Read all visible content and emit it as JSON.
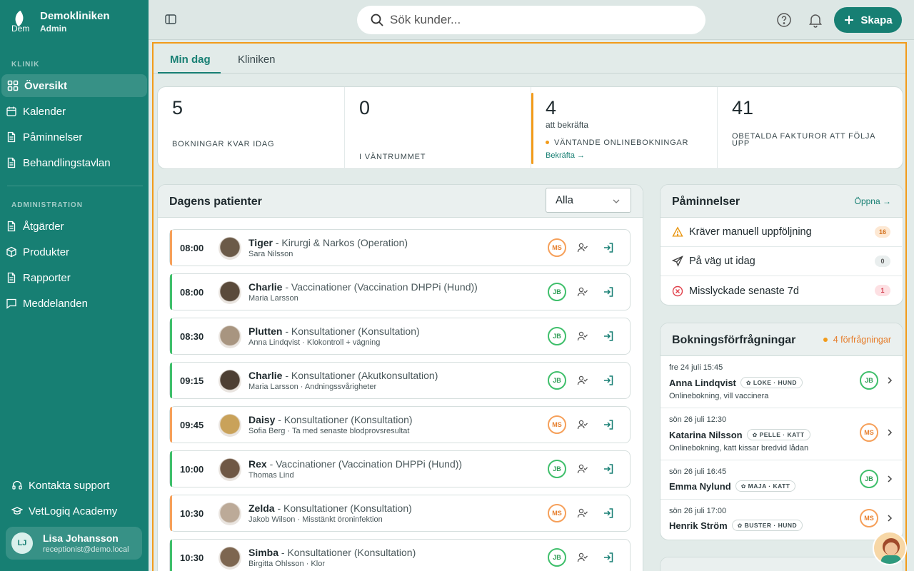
{
  "app": {
    "name": "Demokliniken",
    "role": "Admin",
    "logo_text": "Dem"
  },
  "nav": {
    "section_clinic": "KLINIK",
    "section_admin": "ADMINISTRATION",
    "clinic_items": [
      {
        "label": "Översikt",
        "icon": "grid-icon"
      },
      {
        "label": "Kalender",
        "icon": "calendar-icon"
      },
      {
        "label": "Påminnelser",
        "icon": "document-icon"
      },
      {
        "label": "Behandlingstavlan",
        "icon": "document-icon"
      }
    ],
    "admin_items": [
      {
        "label": "Åtgärder",
        "icon": "document-icon"
      },
      {
        "label": "Produkter",
        "icon": "box-icon"
      },
      {
        "label": "Rapporter",
        "icon": "document-icon"
      },
      {
        "label": "Meddelanden",
        "icon": "message-icon"
      }
    ],
    "footer_items": [
      {
        "label": "Kontakta support",
        "icon": "headset-icon"
      },
      {
        "label": "VetLogiq Academy",
        "icon": "graduation-cap-icon"
      }
    ]
  },
  "user": {
    "initials": "LJ",
    "name": "Lisa Johansson",
    "email": "receptionist@demo.local"
  },
  "topbar": {
    "search_placeholder": "Sök kunder...",
    "create_label": "Skapa"
  },
  "tabs": [
    {
      "label": "Min dag"
    },
    {
      "label": "Kliniken"
    }
  ],
  "stats": [
    {
      "value": "5",
      "label": "BOKNINGAR KVAR IDAG"
    },
    {
      "value": "0",
      "label": "I VÄNTRUMMET"
    },
    {
      "value": "4",
      "sub": "att bekräfta",
      "label": "VÄNTANDE ONLINEBOKNINGAR",
      "link": "Bekräfta →"
    },
    {
      "value": "41",
      "label": "OBETALDA FAKTUROR ATT FÖLJA UPP"
    }
  ],
  "patients": {
    "title": "Dagens patienter",
    "filter": "Alla",
    "rows": [
      {
        "time": "08:00",
        "pet": "Tiger",
        "service": " - Kirurgi & Narkos (Operation)",
        "detail": "Sara Nilsson",
        "staff": "MS",
        "status": "orange"
      },
      {
        "time": "08:00",
        "pet": "Charlie",
        "service": " - Vaccinationer (Vaccination DHPPi (Hund))",
        "detail": "Maria Larsson",
        "staff": "JB",
        "status": "green"
      },
      {
        "time": "08:30",
        "pet": "Plutten",
        "service": " - Konsultationer (Konsultation)",
        "detail": "Anna Lindqvist · Klokontroll + vägning",
        "staff": "JB",
        "status": "green"
      },
      {
        "time": "09:15",
        "pet": "Charlie",
        "service": " - Konsultationer (Akutkonsultation)",
        "detail": "Maria Larsson · Andningssvårigheter",
        "staff": "JB",
        "status": "green"
      },
      {
        "time": "09:45",
        "pet": "Daisy",
        "service": " - Konsultationer (Konsultation)",
        "detail": "Sofia Berg · Ta med senaste blodprovsresultat",
        "staff": "MS",
        "status": "orange"
      },
      {
        "time": "10:00",
        "pet": "Rex",
        "service": " - Vaccinationer (Vaccination DHPPi (Hund))",
        "detail": "Thomas Lind",
        "staff": "JB",
        "status": "green"
      },
      {
        "time": "10:30",
        "pet": "Zelda",
        "service": " - Konsultationer (Konsultation)",
        "detail": "Jakob Wilson · Misstänkt öroninfektion",
        "staff": "MS",
        "status": "orange"
      },
      {
        "time": "10:30",
        "pet": "Simba",
        "service": " - Konsultationer (Konsultation)",
        "detail": "Birgitta Ohlsson · Klor",
        "staff": "JB",
        "status": "green"
      }
    ]
  },
  "reminders": {
    "title": "Påminnelser",
    "open_link": "Öppna →",
    "rows": [
      {
        "label": "Kräver manuell uppföljning",
        "count": "16",
        "icon": "warning-icon"
      },
      {
        "label": "På väg ut idag",
        "count": "0",
        "icon": "send-icon"
      },
      {
        "label": "Misslyckade senaste 7d",
        "count": "1",
        "icon": "error-circle-icon"
      }
    ]
  },
  "requests": {
    "title": "Bokningsförfrågningar",
    "count_label": "4 förfrågningar",
    "rows": [
      {
        "date": "fre 24 juli 15:45",
        "name": "Anna Lindqvist",
        "pet": "LOKE · HUND",
        "note": "Onlinebokning, vill vaccinera",
        "staff": "JB",
        "status": "green"
      },
      {
        "date": "sön 26 juli 12:30",
        "name": "Katarina Nilsson",
        "pet": "PELLE · KATT",
        "note": "Onlinebokning, katt kissar bredvid lådan",
        "staff": "MS",
        "status": "orange"
      },
      {
        "date": "sön 26 juli 16:45",
        "name": "Emma Nylund",
        "pet": "MAJA · KATT",
        "note": "",
        "staff": "JB",
        "status": "green"
      },
      {
        "date": "sön 26 juli 17:00",
        "name": "Henrik Ström",
        "pet": "BUSTER · HUND",
        "note": "",
        "staff": "MS",
        "status": "orange"
      }
    ]
  },
  "colors": {
    "primary": "#177f73",
    "accent_orange": "#f29b1a",
    "green": "#3fbf6b",
    "orange": "#f6a05a",
    "red": "#e0404a"
  }
}
